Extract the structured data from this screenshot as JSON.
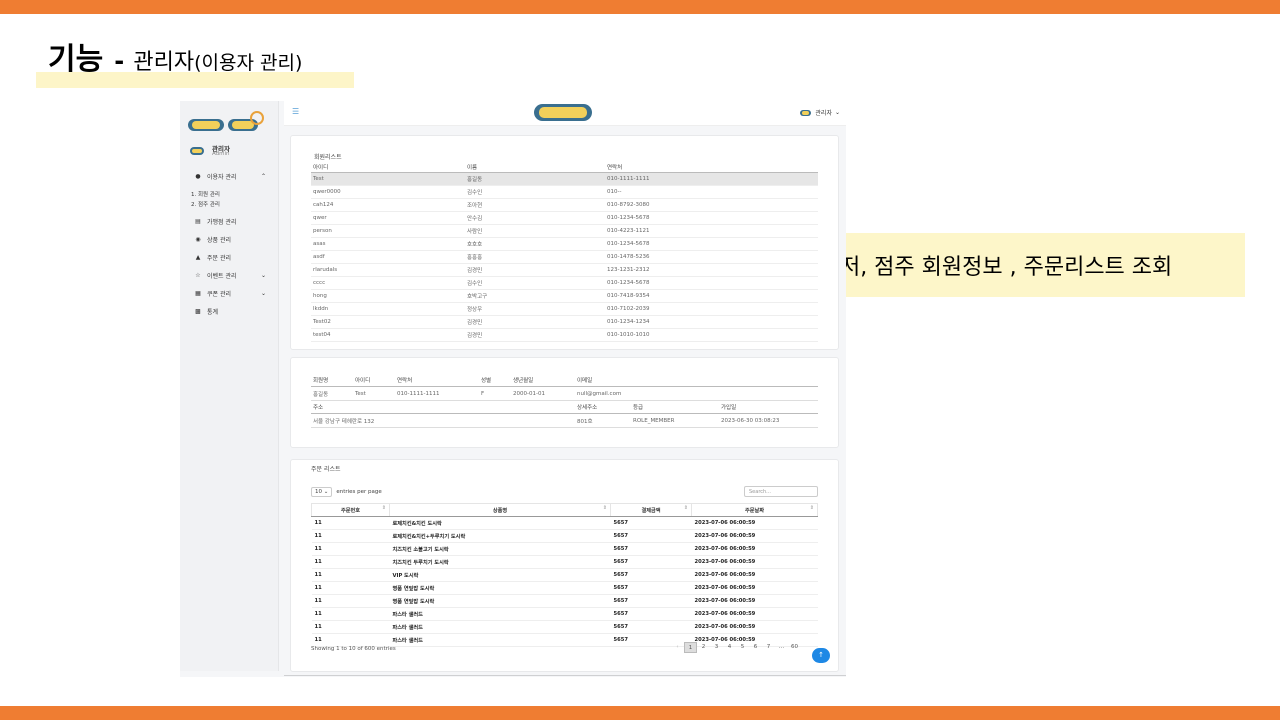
{
  "slide": {
    "title_main": "기능",
    "title_dash": "-",
    "title_sub": "관리자",
    "title_paren": "(이용자 관리)",
    "callout": "유저, 점주 회원정보 , 주문리스트 조회"
  },
  "colors": {
    "accent_bar": "#ef7d32",
    "highlight": "#fdf5c8",
    "primary": "#1e88e5"
  },
  "sidebar": {
    "user_name": "관리자",
    "user_role": "Admin",
    "menu": [
      {
        "label": "이용자 관리",
        "icon": "user-icon",
        "expanded": true
      },
      {
        "label": "가맹점 관리",
        "icon": "store-icon"
      },
      {
        "label": "상품 관리",
        "icon": "bag-icon"
      },
      {
        "label": "주문 관리",
        "icon": "cart-icon"
      },
      {
        "label": "이벤트 관리",
        "icon": "star-icon",
        "has_children": true
      },
      {
        "label": "쿠폰 관리",
        "icon": "gift-icon",
        "has_children": true
      },
      {
        "label": "통계",
        "icon": "chart-icon"
      }
    ],
    "sub_items": [
      "1. 회원 관리",
      "2. 점주 관리"
    ]
  },
  "topnav": {
    "user_label": "관리자"
  },
  "member_list": {
    "title": "회원리스트",
    "headers": [
      "아이디",
      "이름",
      "연락처"
    ],
    "rows": [
      [
        "Test",
        "홍길동",
        "010-1111-1111"
      ],
      [
        "qwer0000",
        "김수인",
        "010--"
      ],
      [
        "cah124",
        "조아현",
        "010-8792-3080"
      ],
      [
        "qwer",
        "안수김",
        "010-1234-5678"
      ],
      [
        "person",
        "사람인",
        "010-4223-1121"
      ],
      [
        "asas",
        "호호호",
        "010-1234-5678"
      ],
      [
        "asdf",
        "홍홍홍",
        "010-1478-5236"
      ],
      [
        "rlarudals",
        "김경민",
        "123-1231-2312"
      ],
      [
        "cccc",
        "김수인",
        "010-1234-5678"
      ],
      [
        "hong",
        "호박고구",
        "010-7418-9354"
      ],
      [
        "lkddn",
        "정상우",
        "010-7102-2039"
      ],
      [
        "Test02",
        "김경민",
        "010-1234-1234"
      ],
      [
        "test04",
        "김경민",
        "010-1010-1010"
      ]
    ]
  },
  "member_detail": {
    "headers1": [
      "회원명",
      "아이디",
      "연락처",
      "성별",
      "생년월일",
      "이메일"
    ],
    "values1": [
      "홍길동",
      "Test",
      "010-1111-1111",
      "F",
      "2000-01-01",
      "null@gmail.com"
    ],
    "headers2": [
      "주소",
      "상세주소",
      "등급",
      "가입일"
    ],
    "values2": [
      "서울 강남구 테헤란로 132",
      "801호",
      "ROLE_MEMBER",
      "2023-06-30 03:08:23"
    ]
  },
  "order_list": {
    "title": "주문 리스트",
    "page_size": "10",
    "entries_label": "entries per page",
    "search_placeholder": "Search...",
    "headers": [
      "주문번호",
      "상품명",
      "결제금액",
      "주문날짜"
    ],
    "rows": [
      [
        "11",
        "로제치킨&치킨 도시락",
        "5657",
        "2023-07-06 06:00:59"
      ],
      [
        "11",
        "로제치킨&치킨+두루치기 도시락",
        "5657",
        "2023-07-06 06:00:59"
      ],
      [
        "11",
        "치즈치킨 소불고기 도시락",
        "5657",
        "2023-07-06 06:00:59"
      ],
      [
        "11",
        "치즈치킨 두루치기 도시락",
        "5657",
        "2023-07-06 06:00:59"
      ],
      [
        "11",
        "VIP 도시락",
        "5657",
        "2023-07-06 06:00:59"
      ],
      [
        "11",
        "명품 연잎밥 도시락",
        "5657",
        "2023-07-06 06:00:59"
      ],
      [
        "11",
        "명품 연잎밥 도시락",
        "5657",
        "2023-07-06 06:00:59"
      ],
      [
        "11",
        "파스타 샐러드",
        "5657",
        "2023-07-06 06:00:59"
      ],
      [
        "11",
        "파스타 샐러드",
        "5657",
        "2023-07-06 06:00:59"
      ],
      [
        "11",
        "파스타 샐러드",
        "5657",
        "2023-07-06 06:00:59"
      ]
    ],
    "showing": "Showing 1 to 10 of 600 entries",
    "pages": [
      "1",
      "2",
      "3",
      "4",
      "5",
      "6",
      "7",
      "...",
      "60"
    ]
  }
}
